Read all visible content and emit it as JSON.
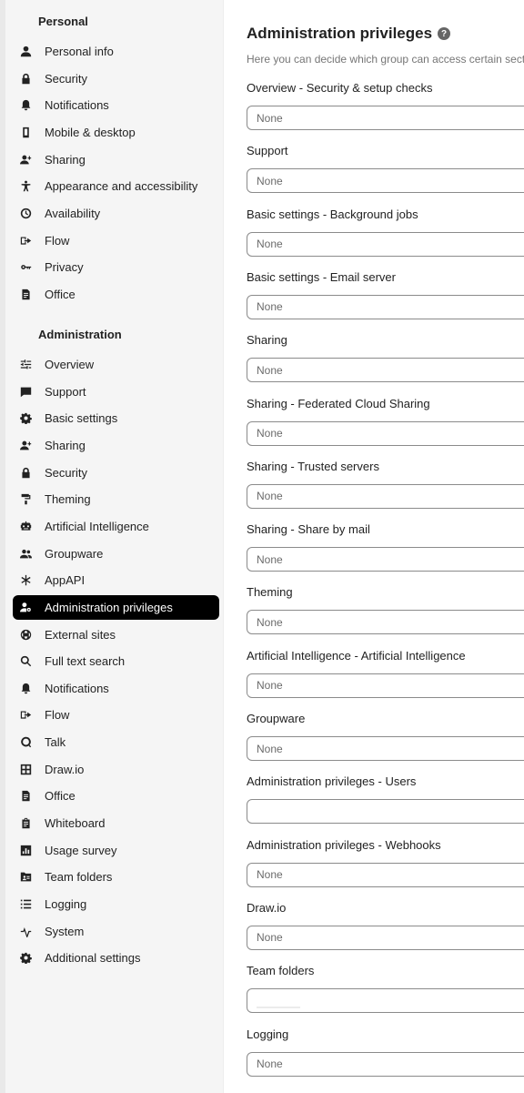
{
  "sidebar": {
    "personal_heading": "Personal",
    "personal_items": [
      {
        "label": "Personal info",
        "icon": "person-icon"
      },
      {
        "label": "Security",
        "icon": "lock-icon"
      },
      {
        "label": "Notifications",
        "icon": "bell-icon"
      },
      {
        "label": "Mobile & desktop",
        "icon": "phone-icon"
      },
      {
        "label": "Sharing",
        "icon": "share-person-icon"
      },
      {
        "label": "Appearance and accessibility",
        "icon": "accessibility-icon"
      },
      {
        "label": "Availability",
        "icon": "clock-icon"
      },
      {
        "label": "Flow",
        "icon": "flow-icon"
      },
      {
        "label": "Privacy",
        "icon": "key-icon"
      },
      {
        "label": "Office",
        "icon": "document-icon"
      }
    ],
    "admin_heading": "Administration",
    "admin_items": [
      {
        "label": "Overview",
        "icon": "sliders-icon"
      },
      {
        "label": "Support",
        "icon": "chat-icon"
      },
      {
        "label": "Basic settings",
        "icon": "gear-icon"
      },
      {
        "label": "Sharing",
        "icon": "share-person-icon"
      },
      {
        "label": "Security",
        "icon": "lock-icon"
      },
      {
        "label": "Theming",
        "icon": "paint-roller-icon"
      },
      {
        "label": "Artificial Intelligence",
        "icon": "robot-icon"
      },
      {
        "label": "Groupware",
        "icon": "group-icon"
      },
      {
        "label": "AppAPI",
        "icon": "asterisk-icon"
      },
      {
        "label": "Administration privileges",
        "icon": "admin-person-icon",
        "active": true
      },
      {
        "label": "External sites",
        "icon": "globe-icon"
      },
      {
        "label": "Full text search",
        "icon": "search-icon"
      },
      {
        "label": "Notifications",
        "icon": "bell-icon"
      },
      {
        "label": "Flow",
        "icon": "flow-icon"
      },
      {
        "label": "Talk",
        "icon": "talk-icon"
      },
      {
        "label": "Draw.io",
        "icon": "drawio-icon"
      },
      {
        "label": "Office",
        "icon": "document-icon"
      },
      {
        "label": "Whiteboard",
        "icon": "whiteboard-icon"
      },
      {
        "label": "Usage survey",
        "icon": "bar-chart-icon"
      },
      {
        "label": "Team folders",
        "icon": "team-folder-icon"
      },
      {
        "label": "Logging",
        "icon": "list-icon"
      },
      {
        "label": "System",
        "icon": "pulse-icon"
      },
      {
        "label": "Additional settings",
        "icon": "gear-icon"
      }
    ]
  },
  "main": {
    "title": "Administration privileges",
    "help_icon": "?",
    "description": "Here you can decide which group can access certain sections",
    "fields": [
      {
        "label": "Overview - Security & setup checks",
        "value": "None"
      },
      {
        "label": "Support",
        "value": "None"
      },
      {
        "label": "Basic settings - Background jobs",
        "value": "None"
      },
      {
        "label": "Basic settings - Email server",
        "value": "None"
      },
      {
        "label": "Sharing",
        "value": "None"
      },
      {
        "label": "Sharing - Federated Cloud Sharing",
        "value": "None"
      },
      {
        "label": "Sharing - Trusted servers",
        "value": "None"
      },
      {
        "label": "Sharing - Share by mail",
        "value": "None"
      },
      {
        "label": "Theming",
        "value": "None"
      },
      {
        "label": "Artificial Intelligence - Artificial Intelligence",
        "value": "None"
      },
      {
        "label": "Groupware",
        "value": "None"
      },
      {
        "label": "Administration privileges - Users",
        "value": ""
      },
      {
        "label": "Administration privileges - Webhooks",
        "value": "None"
      },
      {
        "label": "Draw.io",
        "value": "None"
      },
      {
        "label": "Team folders",
        "value": ""
      },
      {
        "label": "Logging",
        "value": "None"
      }
    ]
  },
  "colors": {
    "active_bg": "#000000",
    "sidebar_bg": "#f5f5f5",
    "field_border": "#8b8b8b"
  }
}
